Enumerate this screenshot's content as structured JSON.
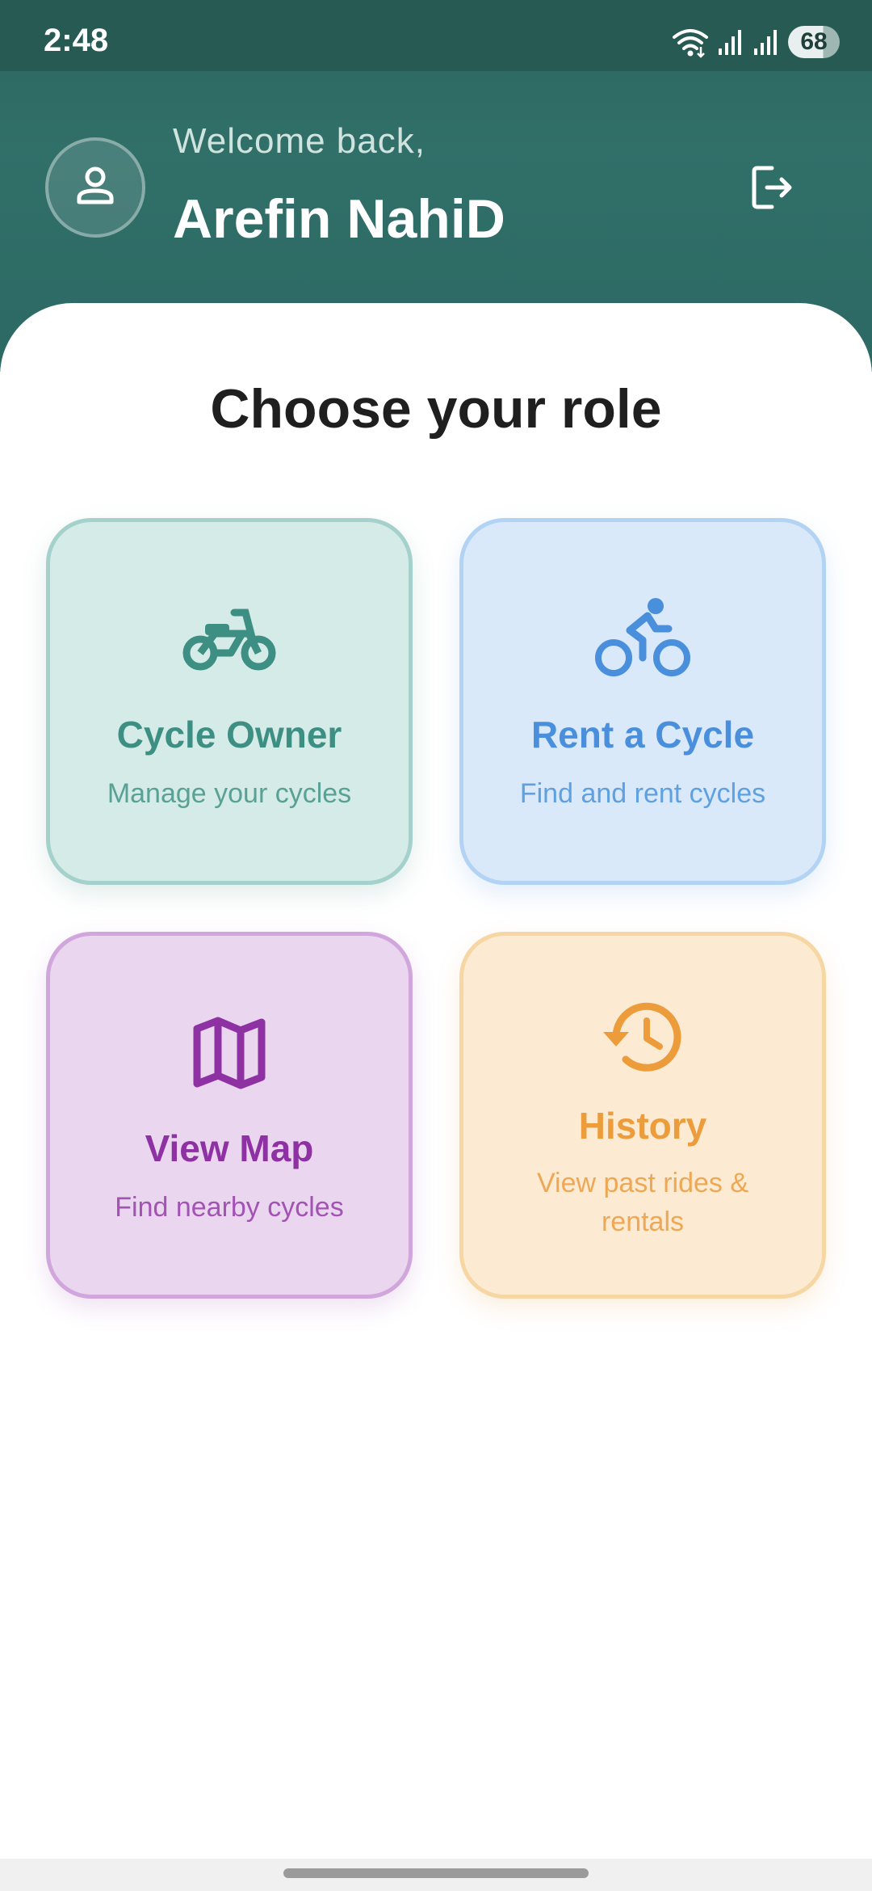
{
  "status_bar": {
    "time": "2:48",
    "battery": "68",
    "icons": [
      "wifi-icon",
      "signal-icon",
      "signal-icon",
      "battery-icon"
    ]
  },
  "header": {
    "welcome": "Welcome back,",
    "user_name": "Arefin NahiD",
    "avatar_icon": "person-icon",
    "logout_icon": "logout-icon"
  },
  "main": {
    "title": "Choose your role",
    "cards": [
      {
        "title": "Cycle Owner",
        "subtitle": "Manage your cycles",
        "icon": "moped-icon",
        "color": "#3e8f83"
      },
      {
        "title": "Rent a Cycle",
        "subtitle": "Find and rent cycles",
        "icon": "cyclist-icon",
        "color": "#4a8fdc"
      },
      {
        "title": "View Map",
        "subtitle": "Find nearby cycles",
        "icon": "map-icon",
        "color": "#8e32a3"
      },
      {
        "title": "History",
        "subtitle": "View past rides & rentals",
        "icon": "history-icon",
        "color": "#ec9c3b"
      }
    ]
  },
  "colors": {
    "header": "#2d6760",
    "status_bar": "#265a53",
    "title_text": "#1f1f1f"
  }
}
